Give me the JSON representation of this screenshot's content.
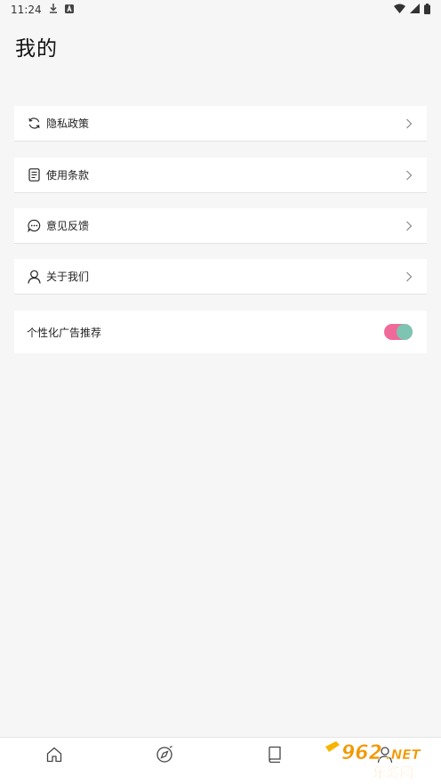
{
  "status_bar": {
    "time": "11:24"
  },
  "page": {
    "title": "我的"
  },
  "menu": [
    {
      "label": "隐私政策",
      "icon": "refresh-icon"
    },
    {
      "label": "使用条款",
      "icon": "document-icon"
    },
    {
      "label": "意见反馈",
      "icon": "chat-bubble-icon"
    },
    {
      "label": "关于我们",
      "icon": "person-icon"
    }
  ],
  "ad_setting": {
    "label": "个性化广告推荐",
    "enabled": true
  },
  "bottom_nav": [
    {
      "icon": "home-icon"
    },
    {
      "icon": "compass-icon"
    },
    {
      "icon": "book-icon"
    },
    {
      "icon": "profile-icon"
    }
  ],
  "watermark": {
    "text_top": "962.NET",
    "text_bottom": "乐游网"
  },
  "colors": {
    "toggle_track": "#f06a99",
    "toggle_knob": "#7dc5b2",
    "background": "#f6f6f6"
  }
}
